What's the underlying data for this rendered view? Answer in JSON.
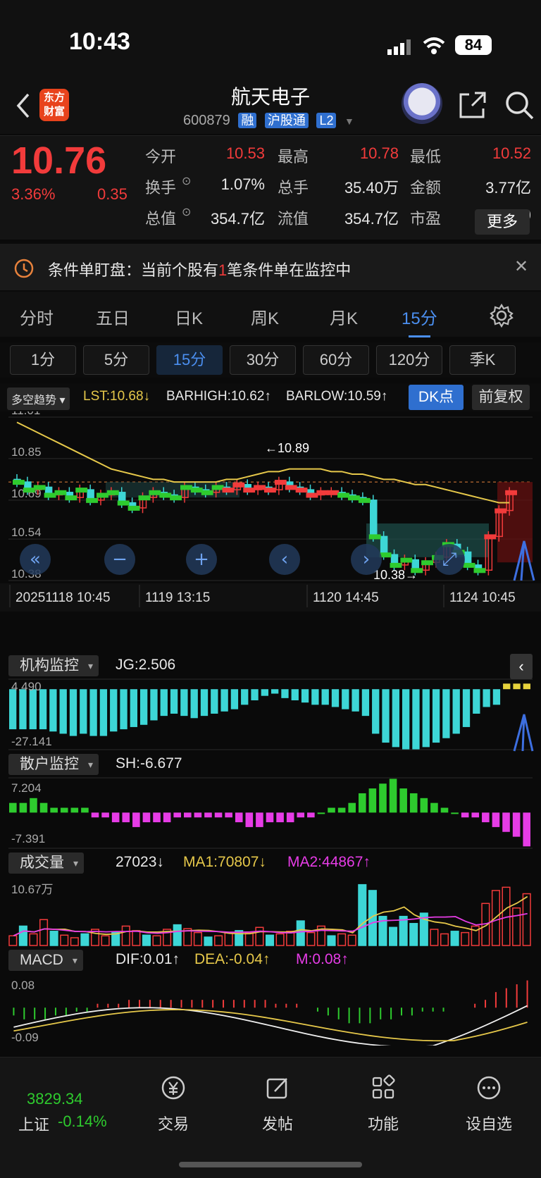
{
  "status": {
    "time": "10:43",
    "battery": "84"
  },
  "header": {
    "logo_line1": "东方",
    "logo_line2": "财富",
    "title": "航天电子",
    "code": "600879",
    "tags": [
      "融",
      "沪股通",
      "L2"
    ]
  },
  "quote": {
    "price": "10.76",
    "change_pct": "3.36%",
    "change": "0.35",
    "rows": [
      [
        {
          "label": "今开",
          "value": "10.53",
          "color": "red"
        },
        {
          "label": "最高",
          "value": "10.78",
          "color": "red"
        },
        {
          "label": "最低",
          "value": "10.52",
          "color": "red"
        }
      ],
      [
        {
          "label": "换手",
          "value": "1.07%",
          "color": "white"
        },
        {
          "label": "总手",
          "value": "35.40万",
          "color": "white"
        },
        {
          "label": "金额",
          "value": "3.77亿",
          "color": "white"
        }
      ],
      [
        {
          "label": "总值",
          "value": "354.7亿",
          "color": "white"
        },
        {
          "label": "流值",
          "value": "354.7亿",
          "color": "white"
        },
        {
          "label": "市盈",
          "value": "127.19",
          "color": "white"
        }
      ]
    ],
    "more": "更多",
    "pe_sup": "动"
  },
  "notice": {
    "prefix": "条件单盯盘：当前个股有",
    "count": "1",
    "suffix": "笔条件单在监控中"
  },
  "period_tabs": [
    "分时",
    "五日",
    "日K",
    "周K",
    "月K",
    "15分"
  ],
  "period_active": 5,
  "minute_tabs": [
    "1分",
    "5分",
    "15分",
    "30分",
    "60分",
    "120分",
    "季K"
  ],
  "minute_active": 2,
  "indicator": {
    "chip": "多空趋势",
    "lst": "LST:10.68↓",
    "barhigh": "BARHIGH:10.62↑",
    "barlow": "BARLOW:10.59↑",
    "dk": "DK点",
    "fq": "前复权"
  },
  "colors": {
    "up": "#f23b3b",
    "down": "#2ecb2e",
    "cyan": "#3dd6d6",
    "accent": "#4b8ff0",
    "yellow": "#e6c84a",
    "magenta": "#e63ce6"
  },
  "chart_data": [
    {
      "type": "candlestick",
      "title": "",
      "y_ticks": [
        "11.01",
        "10.85",
        "10.69",
        "10.54",
        "10.38"
      ],
      "ylim": [
        10.38,
        11.01
      ],
      "x_ticks": [
        "20251118 10:45",
        "1119 13:15",
        "1120 14:45",
        "1124 10:45"
      ],
      "annotations": [
        "←10.89",
        "10.38→"
      ],
      "ma_line": [
        10.99,
        10.97,
        10.95,
        10.93,
        10.91,
        10.89,
        10.87,
        10.85,
        10.83,
        10.81,
        10.8,
        10.79,
        10.78,
        10.77,
        10.77,
        10.76,
        10.76,
        10.76,
        10.76,
        10.76,
        10.77,
        10.77,
        10.78,
        10.79,
        10.8,
        10.8,
        10.81,
        10.81,
        10.81,
        10.81,
        10.8,
        10.8,
        10.79,
        10.79,
        10.78,
        10.77,
        10.77,
        10.76,
        10.75,
        10.75,
        10.74,
        10.73,
        10.72,
        10.71,
        10.7,
        10.69,
        10.68,
        10.68
      ],
      "closes": [
        10.76,
        10.73,
        10.74,
        10.71,
        10.72,
        10.7,
        10.73,
        10.69,
        10.71,
        10.72,
        10.68,
        10.66,
        10.7,
        10.72,
        10.71,
        10.7,
        10.74,
        10.73,
        10.72,
        10.74,
        10.73,
        10.75,
        10.73,
        10.74,
        10.73,
        10.76,
        10.74,
        10.73,
        10.71,
        10.72,
        10.72,
        10.71,
        10.7,
        10.69,
        10.55,
        10.48,
        10.44,
        10.46,
        10.42,
        10.45,
        10.47,
        10.52,
        10.49,
        10.44,
        10.42,
        10.55,
        10.65,
        10.72
      ]
    },
    {
      "type": "bar",
      "title": "机构监控",
      "value_label": "JG:2.506",
      "y_ticks": [
        "4.490",
        "-27.141"
      ],
      "ylim": [
        -27.141,
        4.49
      ],
      "values": [
        -18,
        -18,
        -18,
        -18,
        -19,
        -20,
        -21,
        -20,
        -21,
        -21,
        -19,
        -18,
        -17,
        -16,
        -14,
        -12,
        -11,
        -12,
        -13,
        -12,
        -11,
        -10,
        -9,
        -7,
        -5,
        -3,
        -2,
        -4,
        -5,
        -6,
        -7,
        -7,
        -8,
        -9,
        -10,
        -12,
        -20,
        -24,
        -26,
        -27,
        -27,
        -26,
        -24,
        -22,
        -20,
        -17,
        -11,
        -8,
        -7,
        2.5,
        2.5,
        2.5
      ]
    },
    {
      "type": "bar",
      "title": "散户监控",
      "value_label": "SH:-6.677",
      "y_ticks": [
        "7.204",
        "-7.391"
      ],
      "ylim": [
        -7.391,
        7.204
      ],
      "values": [
        2,
        2,
        3,
        2,
        1,
        1,
        1,
        1,
        -1,
        -1,
        -2,
        -2,
        -3,
        -2,
        -2,
        -2,
        -1,
        -1,
        -1,
        -1,
        -1,
        -1,
        -2,
        -3,
        -3,
        -2,
        -2,
        -2,
        -1,
        -1,
        0,
        1,
        1,
        2,
        4,
        5,
        6,
        7,
        5,
        4,
        3,
        2,
        1,
        0,
        -1,
        -1,
        -2,
        -3,
        -4,
        -5,
        -7
      ]
    },
    {
      "type": "bar",
      "title": "成交量",
      "vol_label": "27023↓",
      "ma1_label": "MA1:70807↓",
      "ma2_label": "MA2:44867↑",
      "y_ticks": [
        "10.67万"
      ],
      "ylim": [
        0,
        10.67
      ],
      "values": [
        1.5,
        3,
        1.8,
        4,
        2.2,
        1.6,
        1.2,
        1.8,
        2.5,
        1.5,
        2,
        3,
        2.3,
        1.6,
        1.5,
        2.5,
        3.2,
        2.6,
        2,
        1.3,
        1.5,
        2,
        2.3,
        2,
        2.8,
        1.6,
        1.8,
        2.2,
        3.8,
        2,
        3,
        1.5,
        1.8,
        1.6,
        9.4,
        8.5,
        4.5,
        2.8,
        4.5,
        3.4,
        5,
        2.5,
        1.8,
        2.2,
        2,
        3,
        6.5,
        8.5,
        9,
        5.8,
        8
      ]
    },
    {
      "type": "bar",
      "title": "MACD",
      "dif_label": "DIF:0.01↑",
      "dea_label": "DEA:-0.04↑",
      "m_label": "M:0.08↑",
      "y_ticks": [
        "0.08",
        "-0.09"
      ],
      "ylim": [
        -0.09,
        0.08
      ],
      "values": [
        -0.02,
        -0.03,
        -0.03,
        -0.03,
        -0.02,
        -0.02,
        -0.01,
        -0.01,
        0.01,
        0.01,
        0.01,
        0.02,
        0.02,
        0.02,
        0.02,
        0.02,
        0.02,
        0.02,
        0.02,
        0.02,
        0.02,
        0.02,
        0.02,
        0.02,
        0.02,
        0.01,
        0.01,
        0.01,
        0,
        -0.01,
        -0.02,
        -0.03,
        -0.04,
        -0.04,
        -0.04,
        -0.03,
        -0.03,
        -0.02,
        -0.02,
        -0.01,
        -0.01,
        -0.01,
        0,
        0,
        0.01,
        0.02,
        0.04,
        0.05,
        0.06,
        0.07
      ]
    }
  ],
  "bottom": {
    "index_value": "3829.34",
    "index_name": "上证",
    "index_pct": "-0.14%",
    "nav": [
      {
        "label": "交易",
        "icon": "yuan-icon"
      },
      {
        "label": "发帖",
        "icon": "edit-icon"
      },
      {
        "label": "功能",
        "icon": "grid-icon"
      },
      {
        "label": "设自选",
        "icon": "more-icon"
      }
    ]
  }
}
